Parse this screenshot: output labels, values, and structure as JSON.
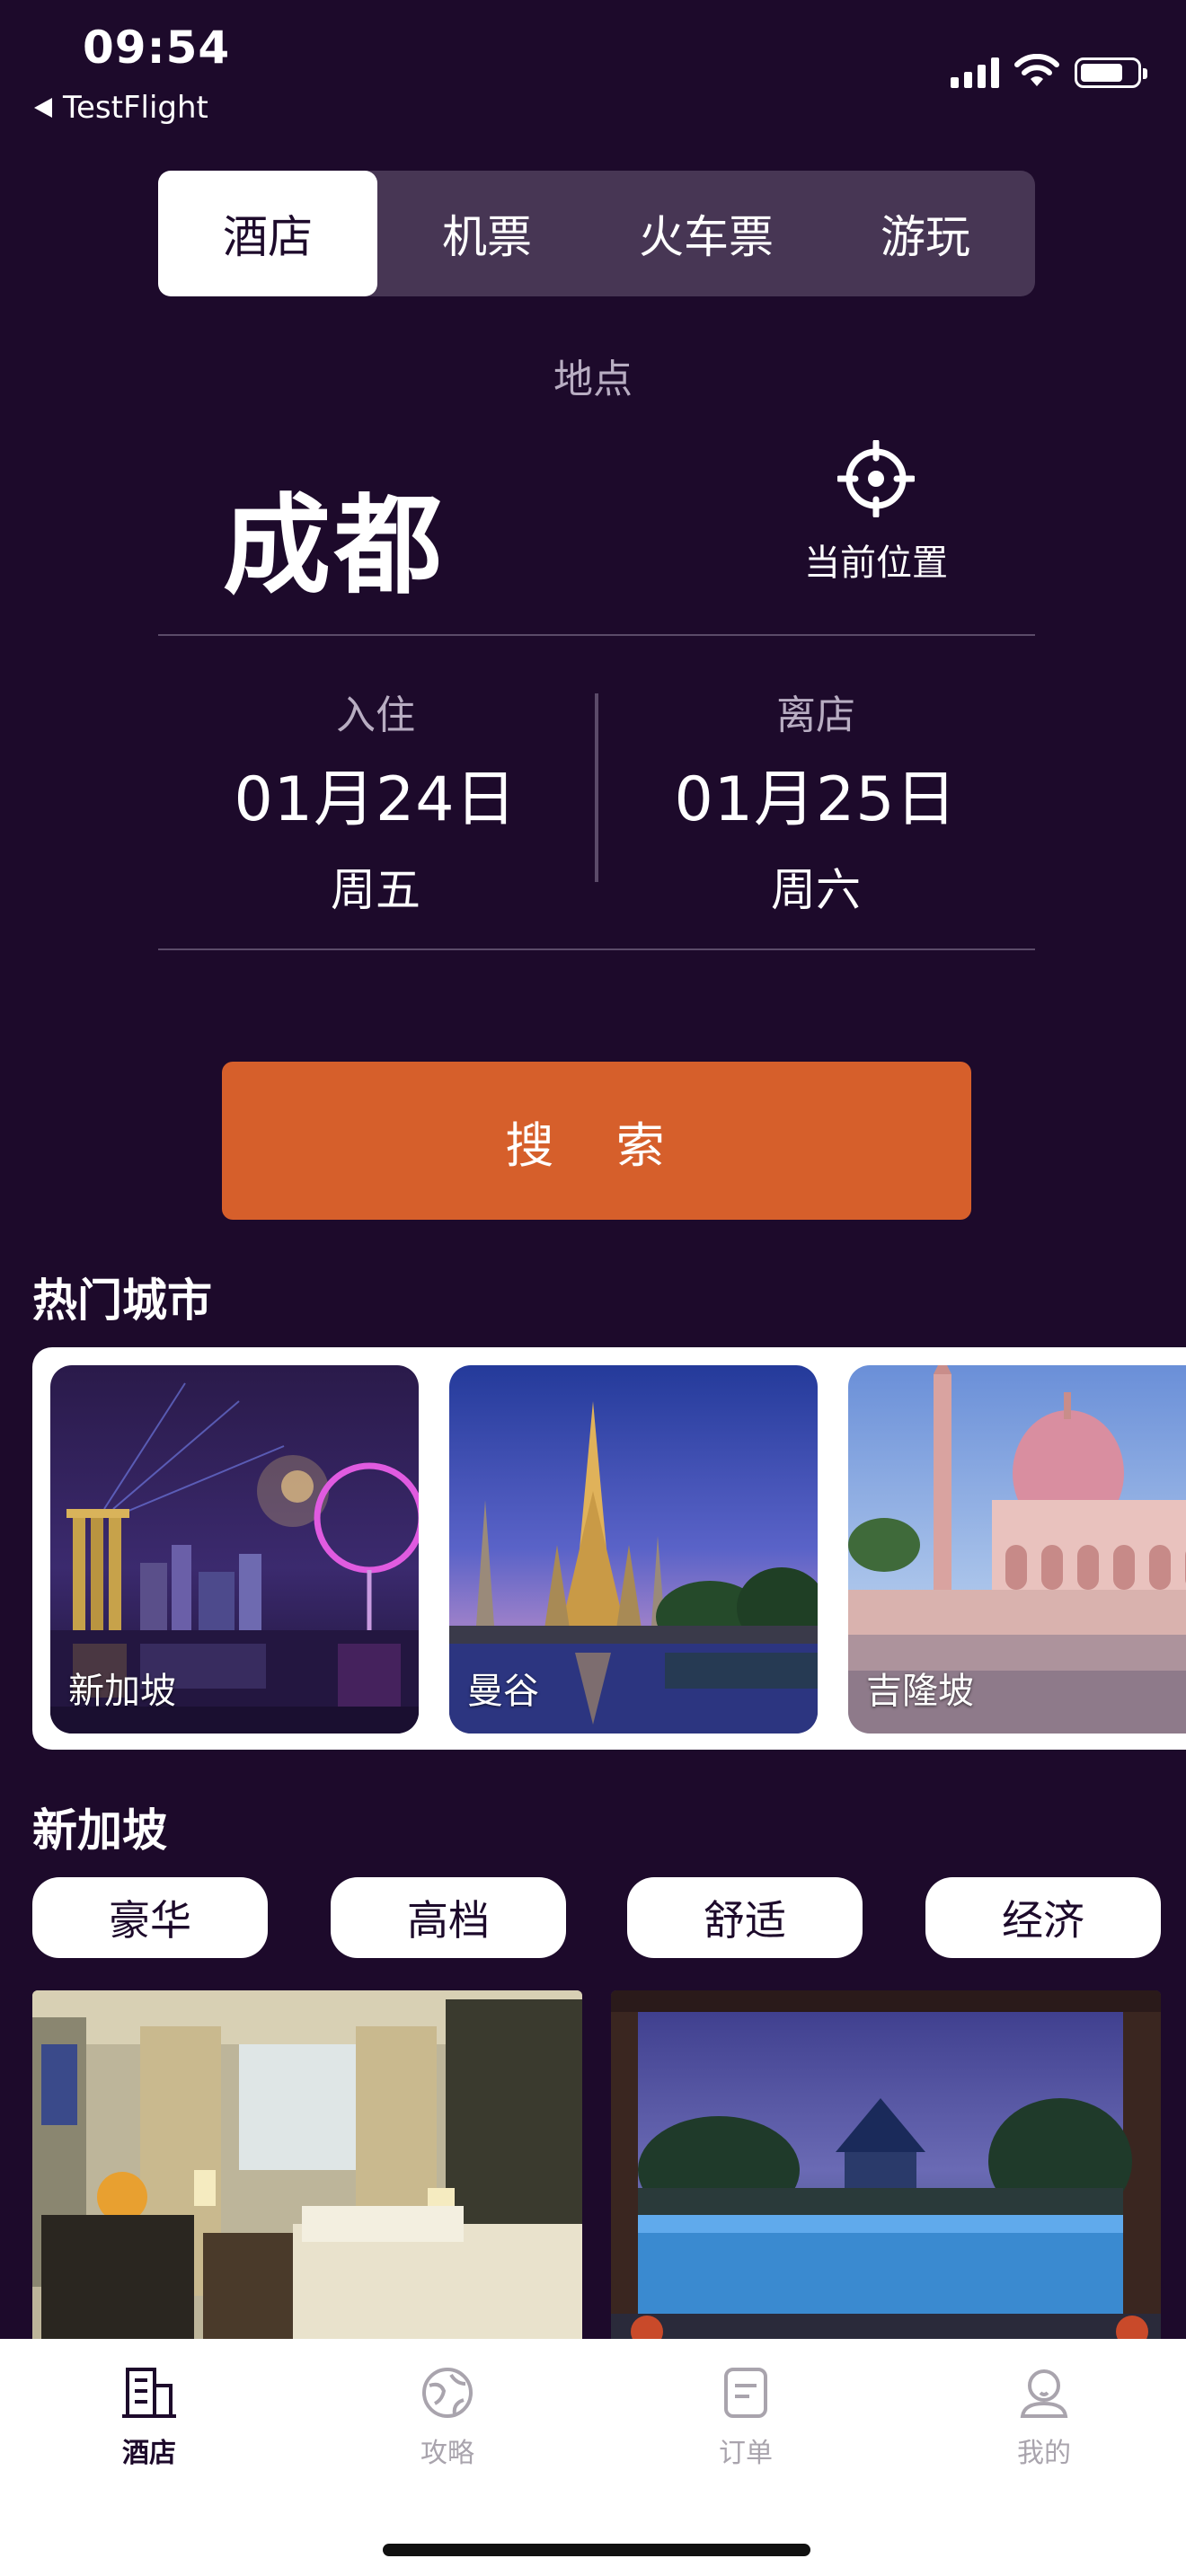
{
  "status_bar": {
    "time": "09:54",
    "back_label": "TestFlight",
    "battery_level": 0.8
  },
  "tabs": [
    {
      "label": "酒店",
      "active": true
    },
    {
      "label": "机票",
      "active": false
    },
    {
      "label": "火车票",
      "active": false
    },
    {
      "label": "游玩",
      "active": false
    }
  ],
  "location": {
    "label": "地点",
    "city": "成都",
    "current_location_label": "当前位置"
  },
  "dates": {
    "checkin": {
      "label": "入住",
      "date": "01月24日",
      "weekday": "周五"
    },
    "checkout": {
      "label": "离店",
      "date": "01月25日",
      "weekday": "周六"
    }
  },
  "search_label": "搜 索",
  "hot_cities": {
    "title": "热门城市",
    "items": [
      {
        "name": "新加坡",
        "icon": "singapore-night-photo"
      },
      {
        "name": "曼谷",
        "icon": "bangkok-temple-photo"
      },
      {
        "name": "吉隆坡",
        "icon": "kuala-lumpur-mosque-photo"
      }
    ]
  },
  "selected_city": {
    "title": "新加坡",
    "categories": [
      "豪华",
      "高档",
      "舒适",
      "经济"
    ]
  },
  "hotels": [
    {
      "icon": "hotel-room-photo"
    },
    {
      "icon": "hotel-pool-photo"
    }
  ],
  "tabbar": [
    {
      "label": "酒店",
      "icon": "building-icon",
      "active": true
    },
    {
      "label": "攻略",
      "icon": "globe-icon",
      "active": false
    },
    {
      "label": "订单",
      "icon": "order-list-icon",
      "active": false
    },
    {
      "label": "我的",
      "icon": "person-icon",
      "active": false
    }
  ],
  "colors": {
    "background": "#1d0a2b",
    "accent": "#d65f2b",
    "tab_inactive_bg": "#473654",
    "muted_text": "#b8adc2"
  }
}
